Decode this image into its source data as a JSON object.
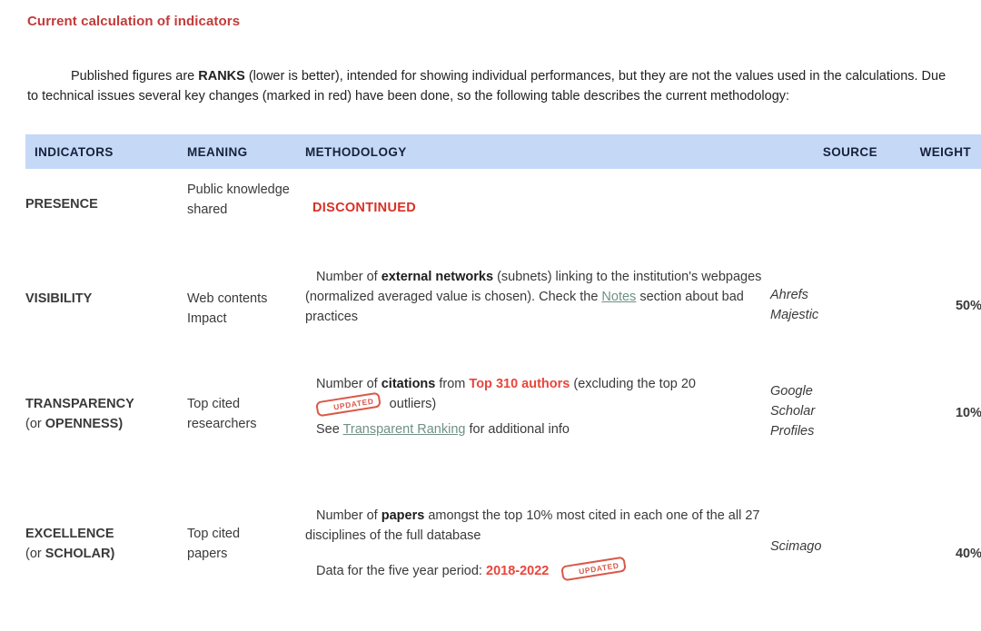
{
  "section": {
    "title": "Current calculation of indicators",
    "intro_parts": {
      "a": "Published figures are ",
      "b_ranks": "RANKS",
      "c": " (lower is better), intended for showing individual performances, but they are not the values used in the calculations. Due to technical issues several key changes (marked in red) have been done, so the following table describes the current methodology:"
    }
  },
  "table": {
    "headers": {
      "indicators": "INDICATORS",
      "meaning": "MEANING",
      "methodology": "METHODOLOGY",
      "source": "SOURCE",
      "weight": "WEIGHT"
    },
    "rows": [
      {
        "indicator": "PRESENCE",
        "indicator_sub": "",
        "meaning": "Public knowledge shared",
        "methodology_status": "DISCONTINUED",
        "source": "",
        "weight": ""
      },
      {
        "indicator": "VISIBILITY",
        "indicator_sub": "",
        "meaning_l1": "Web contents",
        "meaning_l2": "Impact",
        "methodology": {
          "p1_a": "Number of ",
          "p1_bold": "external networks",
          "p1_b": " (subnets) linking to the institution's webpages (normalized averaged value is chosen). Check the ",
          "p1_link": "Notes",
          "p1_c": " section about bad practices"
        },
        "source_l1": "Ahrefs",
        "source_l2": "Majestic",
        "weight": "50%"
      },
      {
        "indicator": "TRANSPARENCY",
        "indicator_sub_normal": "(or ",
        "indicator_sub_bold": "OPENNESS)",
        "meaning_l1": "Top cited",
        "meaning_l2": "researchers",
        "methodology": {
          "p1_a": "Number of ",
          "p1_bold": "citations",
          "p1_b": " from ",
          "p1_red": "Top 310 authors",
          "p1_c": " (excluding the top 20 ",
          "stamp": "UPDATED",
          "p1_d": " outliers)",
          "p2_a": "See ",
          "p2_link": "Transparent Ranking",
          "p2_b": " for additional info"
        },
        "source_l1": "Google",
        "source_l2": "Scholar",
        "source_l3": "Profiles",
        "weight": "10%"
      },
      {
        "indicator": "EXCELLENCE",
        "indicator_sub_normal": "(or ",
        "indicator_sub_bold": "SCHOLAR)",
        "meaning_l1": "Top cited",
        "meaning_l2": "papers",
        "methodology": {
          "p1_a": "Number of ",
          "p1_bold": "papers",
          "p1_b": " amongst the top 10% most cited in each one of the all 27 disciplines of the full database",
          "p2_a": "Data for the five year period: ",
          "p2_red": "2018-2022",
          "stamp": "UPDATED"
        },
        "source": "Scimago",
        "weight": "40%"
      }
    ]
  },
  "colors": {
    "title_red": "#c23b3b",
    "header_bg": "#c5d9f7",
    "accent_red": "#e8453c",
    "discontinued_red": "#d93025",
    "link": "#6f9183",
    "stamp_red": "#d64a3a"
  }
}
